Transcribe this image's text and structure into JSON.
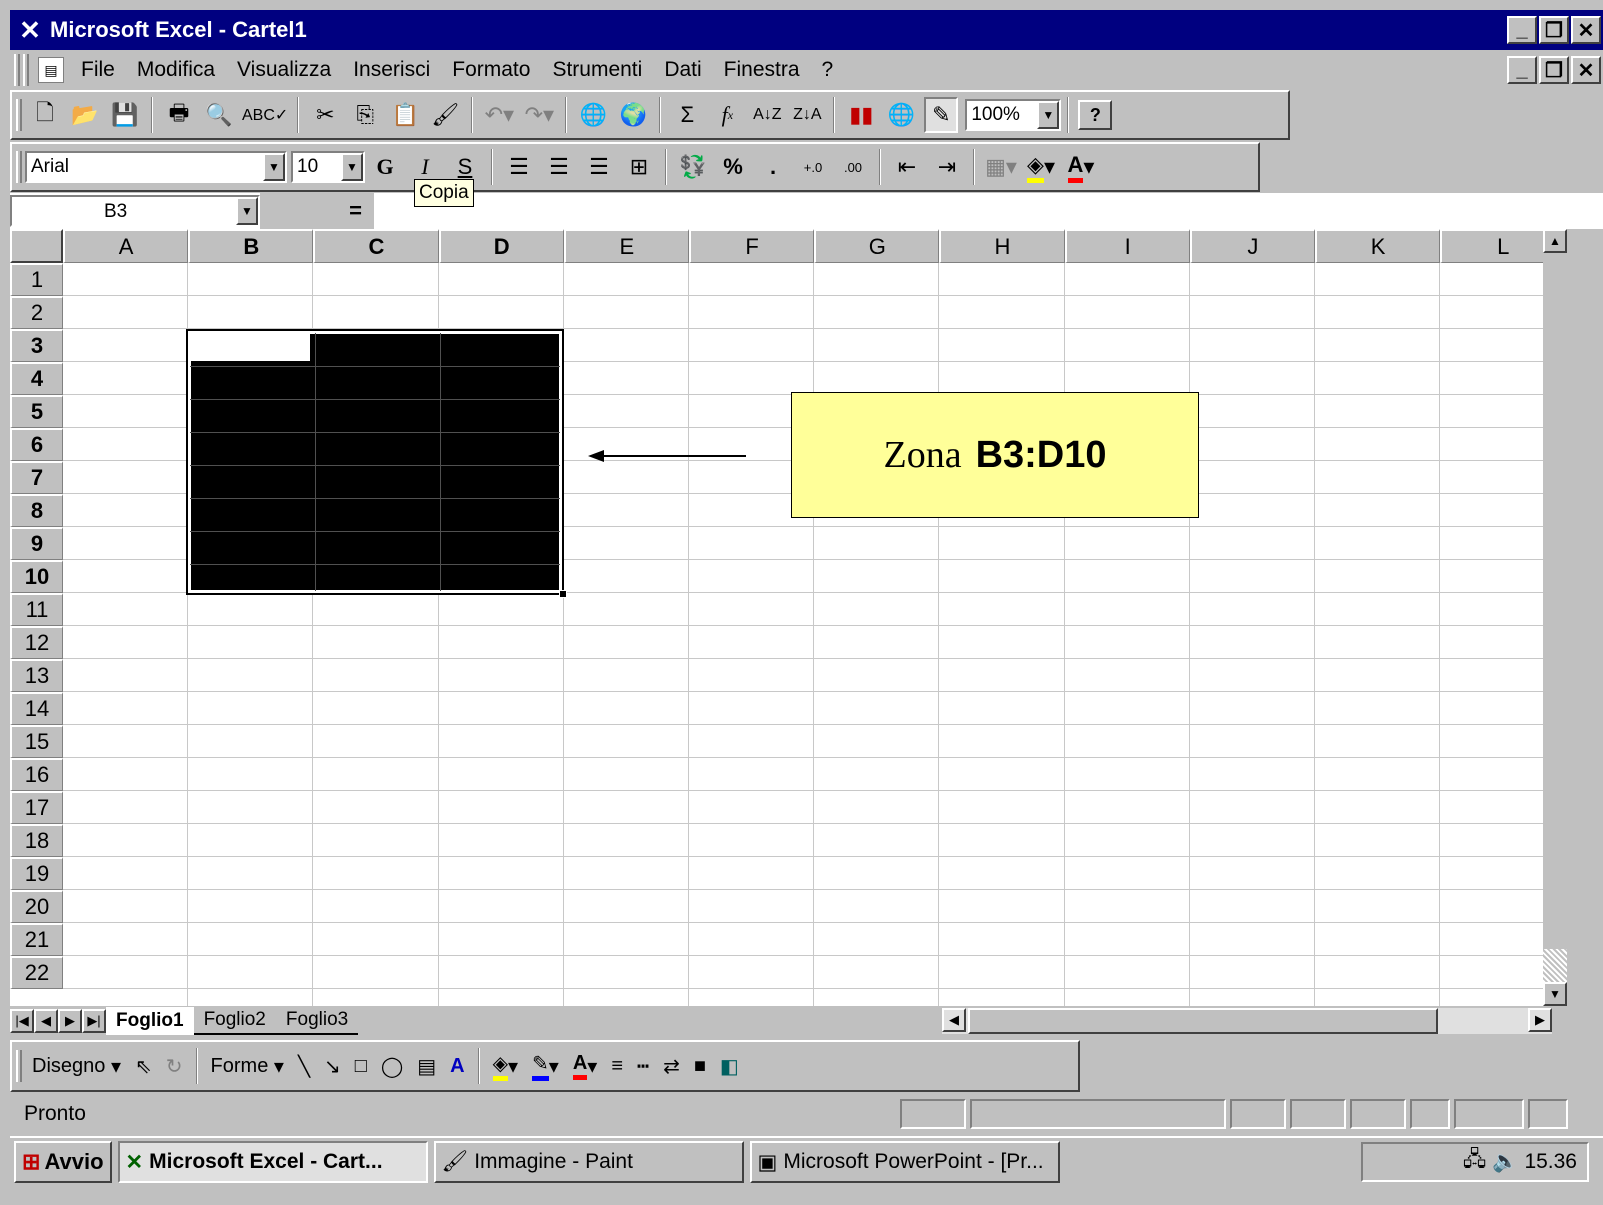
{
  "window": {
    "title": "Microsoft Excel - Cartel1"
  },
  "menu": {
    "items": [
      "File",
      "Modifica",
      "Visualizza",
      "Inserisci",
      "Formato",
      "Strumenti",
      "Dati",
      "Finestra",
      "?"
    ]
  },
  "toolbar": {
    "zoom": "100%"
  },
  "format_toolbar": {
    "font": "Arial",
    "size": "10",
    "bold": "G",
    "italic": "I",
    "underline": "S",
    "percent": "%",
    "thousands": "."
  },
  "tooltip": {
    "text": "Copia"
  },
  "formula_bar": {
    "cell_ref": "B3",
    "equals": "="
  },
  "sheet": {
    "columns": [
      "A",
      "B",
      "C",
      "D",
      "E",
      "F",
      "G",
      "H",
      "I",
      "J",
      "K",
      "L"
    ],
    "rows": [
      "1",
      "2",
      "3",
      "4",
      "5",
      "6",
      "7",
      "8",
      "9",
      "10",
      "11",
      "12",
      "13",
      "14",
      "15",
      "16",
      "17",
      "18",
      "19",
      "20",
      "21",
      "22"
    ],
    "selected_columns": [
      "B",
      "C",
      "D"
    ],
    "selected_rows": [
      "3",
      "4",
      "5",
      "6",
      "7",
      "8",
      "9",
      "10"
    ]
  },
  "callout": {
    "prefix": "Zona",
    "range": "B3:D10"
  },
  "tabs": [
    "Foglio1",
    "Foglio2",
    "Foglio3"
  ],
  "drawing": {
    "draw_label": "Disegno",
    "shapes_label": "Forme"
  },
  "status": {
    "text": "Pronto"
  },
  "taskbar": {
    "start": "Avvio",
    "tasks": [
      "Microsoft Excel - Cart...",
      "Immagine - Paint",
      "Microsoft PowerPoint - [Pr..."
    ],
    "clock": "15.36"
  }
}
